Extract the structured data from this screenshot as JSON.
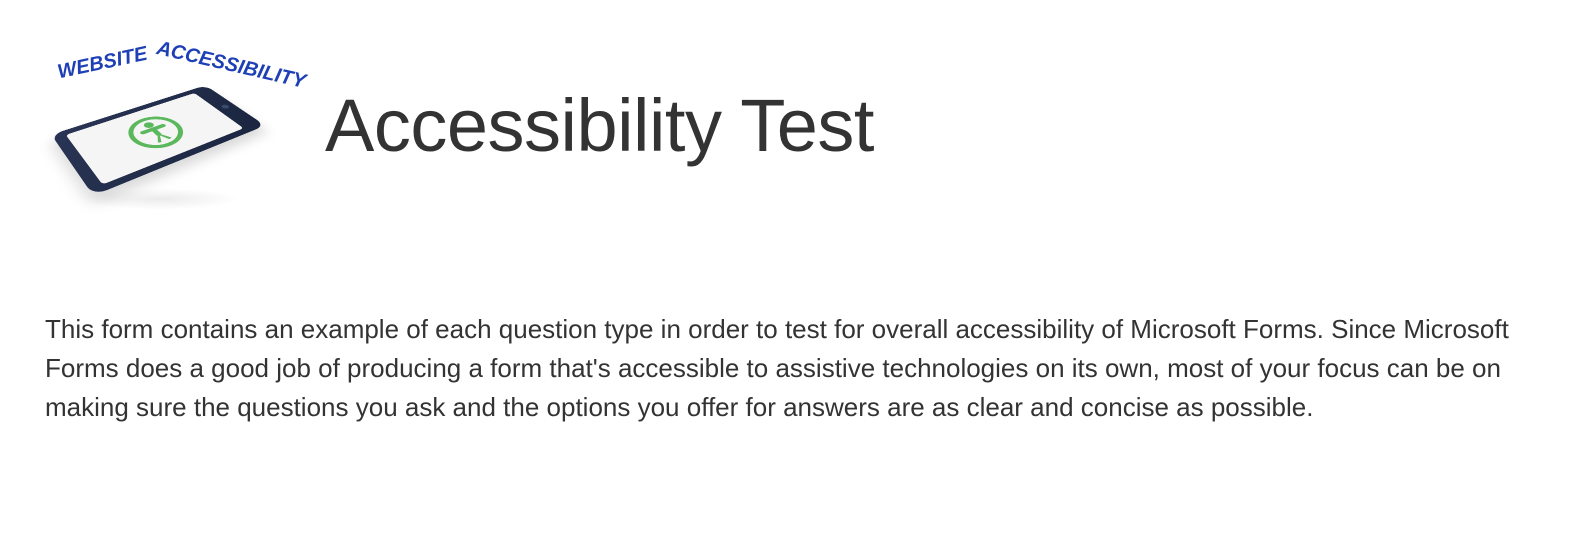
{
  "header": {
    "title": "Accessibility Test",
    "logo_text_1": "WEBSITE",
    "logo_text_2": "ACCESSIBILITY"
  },
  "body": {
    "description": "This form contains an example of each question type in order to test for overall accessibility of Microsoft Forms. Since Microsoft Forms does a good job of producing a form that's accessible to assistive technologies on its own, most of your focus can be on making sure the questions you ask and the options you offer for answers are as clear and concise as possible."
  }
}
